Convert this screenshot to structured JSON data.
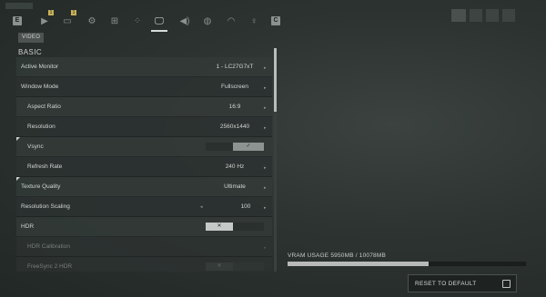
{
  "top_nav": {
    "tabs": [
      {
        "name": "key-e-icon",
        "glyph": "E"
      },
      {
        "name": "play-tab-icon",
        "glyph": "▶",
        "badge": "1"
      },
      {
        "name": "controller-tab-icon",
        "glyph": "▭",
        "badge": "1"
      },
      {
        "name": "gear-tab-icon",
        "glyph": "⚙"
      },
      {
        "name": "network-tab-icon",
        "glyph": "⊞"
      },
      {
        "name": "nodes-tab-icon",
        "glyph": "⁘"
      },
      {
        "name": "monitor-tab-icon",
        "glyph": "🖵",
        "active": true
      },
      {
        "name": "speaker-tab-icon",
        "glyph": "◀)"
      },
      {
        "name": "chat-tab-icon",
        "glyph": "◍"
      },
      {
        "name": "headset-tab-icon",
        "glyph": "◠"
      },
      {
        "name": "figure-tab-icon",
        "glyph": "♀"
      },
      {
        "name": "key-c-icon",
        "glyph": "C"
      }
    ]
  },
  "page": {
    "badge": "VIDEO",
    "section": "BASIC"
  },
  "settings": [
    {
      "label": "Active Monitor",
      "value": "1 - LC27G7xT",
      "sub": false,
      "type": "select"
    },
    {
      "label": "Window Mode",
      "value": "Fullscreen",
      "sub": false,
      "type": "select"
    },
    {
      "label": "Aspect Ratio",
      "value": "16:9",
      "sub": true,
      "type": "select"
    },
    {
      "label": "Resolution",
      "value": "2560x1440",
      "sub": true,
      "type": "select"
    },
    {
      "label": "Vsync",
      "value": "✓",
      "sub": true,
      "type": "toggle-on",
      "changed": true
    },
    {
      "label": "Refresh Rate",
      "value": "240 Hz",
      "sub": true,
      "type": "select"
    },
    {
      "label": "Texture Quality",
      "value": "Ultimate",
      "sub": false,
      "type": "select",
      "changed": true
    },
    {
      "label": "Resolution Scaling",
      "value": "100",
      "sub": false,
      "type": "stepper"
    },
    {
      "label": "HDR",
      "value": "✕",
      "sub": false,
      "type": "toggle-off"
    },
    {
      "label": "HDR Calibration",
      "value": "",
      "sub": true,
      "type": "disabled"
    },
    {
      "label": "FreeSync 2 HDR",
      "value": "✕",
      "sub": true,
      "type": "disabled-toggle"
    }
  ],
  "vram": {
    "label": "VRAM USAGE 5950MB / 10078MB",
    "fraction": 0.59
  },
  "actions": {
    "reset_label": "RESET TO DEFAULT"
  }
}
